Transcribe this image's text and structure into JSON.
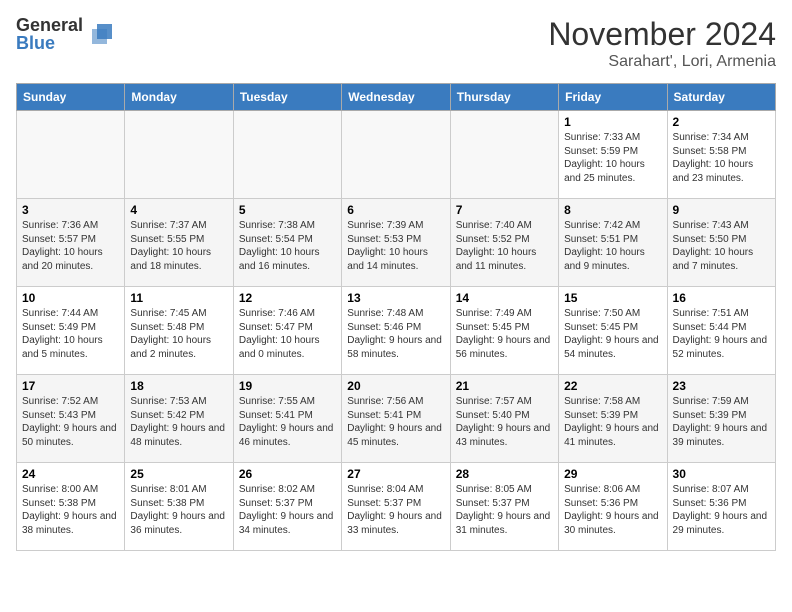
{
  "header": {
    "logo_general": "General",
    "logo_blue": "Blue",
    "month": "November 2024",
    "location": "Sarahart', Lori, Armenia"
  },
  "weekdays": [
    "Sunday",
    "Monday",
    "Tuesday",
    "Wednesday",
    "Thursday",
    "Friday",
    "Saturday"
  ],
  "weeks": [
    [
      {
        "day": "",
        "info": ""
      },
      {
        "day": "",
        "info": ""
      },
      {
        "day": "",
        "info": ""
      },
      {
        "day": "",
        "info": ""
      },
      {
        "day": "",
        "info": ""
      },
      {
        "day": "1",
        "info": "Sunrise: 7:33 AM\nSunset: 5:59 PM\nDaylight: 10 hours and 25 minutes."
      },
      {
        "day": "2",
        "info": "Sunrise: 7:34 AM\nSunset: 5:58 PM\nDaylight: 10 hours and 23 minutes."
      }
    ],
    [
      {
        "day": "3",
        "info": "Sunrise: 7:36 AM\nSunset: 5:57 PM\nDaylight: 10 hours and 20 minutes."
      },
      {
        "day": "4",
        "info": "Sunrise: 7:37 AM\nSunset: 5:55 PM\nDaylight: 10 hours and 18 minutes."
      },
      {
        "day": "5",
        "info": "Sunrise: 7:38 AM\nSunset: 5:54 PM\nDaylight: 10 hours and 16 minutes."
      },
      {
        "day": "6",
        "info": "Sunrise: 7:39 AM\nSunset: 5:53 PM\nDaylight: 10 hours and 14 minutes."
      },
      {
        "day": "7",
        "info": "Sunrise: 7:40 AM\nSunset: 5:52 PM\nDaylight: 10 hours and 11 minutes."
      },
      {
        "day": "8",
        "info": "Sunrise: 7:42 AM\nSunset: 5:51 PM\nDaylight: 10 hours and 9 minutes."
      },
      {
        "day": "9",
        "info": "Sunrise: 7:43 AM\nSunset: 5:50 PM\nDaylight: 10 hours and 7 minutes."
      }
    ],
    [
      {
        "day": "10",
        "info": "Sunrise: 7:44 AM\nSunset: 5:49 PM\nDaylight: 10 hours and 5 minutes."
      },
      {
        "day": "11",
        "info": "Sunrise: 7:45 AM\nSunset: 5:48 PM\nDaylight: 10 hours and 2 minutes."
      },
      {
        "day": "12",
        "info": "Sunrise: 7:46 AM\nSunset: 5:47 PM\nDaylight: 10 hours and 0 minutes."
      },
      {
        "day": "13",
        "info": "Sunrise: 7:48 AM\nSunset: 5:46 PM\nDaylight: 9 hours and 58 minutes."
      },
      {
        "day": "14",
        "info": "Sunrise: 7:49 AM\nSunset: 5:45 PM\nDaylight: 9 hours and 56 minutes."
      },
      {
        "day": "15",
        "info": "Sunrise: 7:50 AM\nSunset: 5:45 PM\nDaylight: 9 hours and 54 minutes."
      },
      {
        "day": "16",
        "info": "Sunrise: 7:51 AM\nSunset: 5:44 PM\nDaylight: 9 hours and 52 minutes."
      }
    ],
    [
      {
        "day": "17",
        "info": "Sunrise: 7:52 AM\nSunset: 5:43 PM\nDaylight: 9 hours and 50 minutes."
      },
      {
        "day": "18",
        "info": "Sunrise: 7:53 AM\nSunset: 5:42 PM\nDaylight: 9 hours and 48 minutes."
      },
      {
        "day": "19",
        "info": "Sunrise: 7:55 AM\nSunset: 5:41 PM\nDaylight: 9 hours and 46 minutes."
      },
      {
        "day": "20",
        "info": "Sunrise: 7:56 AM\nSunset: 5:41 PM\nDaylight: 9 hours and 45 minutes."
      },
      {
        "day": "21",
        "info": "Sunrise: 7:57 AM\nSunset: 5:40 PM\nDaylight: 9 hours and 43 minutes."
      },
      {
        "day": "22",
        "info": "Sunrise: 7:58 AM\nSunset: 5:39 PM\nDaylight: 9 hours and 41 minutes."
      },
      {
        "day": "23",
        "info": "Sunrise: 7:59 AM\nSunset: 5:39 PM\nDaylight: 9 hours and 39 minutes."
      }
    ],
    [
      {
        "day": "24",
        "info": "Sunrise: 8:00 AM\nSunset: 5:38 PM\nDaylight: 9 hours and 38 minutes."
      },
      {
        "day": "25",
        "info": "Sunrise: 8:01 AM\nSunset: 5:38 PM\nDaylight: 9 hours and 36 minutes."
      },
      {
        "day": "26",
        "info": "Sunrise: 8:02 AM\nSunset: 5:37 PM\nDaylight: 9 hours and 34 minutes."
      },
      {
        "day": "27",
        "info": "Sunrise: 8:04 AM\nSunset: 5:37 PM\nDaylight: 9 hours and 33 minutes."
      },
      {
        "day": "28",
        "info": "Sunrise: 8:05 AM\nSunset: 5:37 PM\nDaylight: 9 hours and 31 minutes."
      },
      {
        "day": "29",
        "info": "Sunrise: 8:06 AM\nSunset: 5:36 PM\nDaylight: 9 hours and 30 minutes."
      },
      {
        "day": "30",
        "info": "Sunrise: 8:07 AM\nSunset: 5:36 PM\nDaylight: 9 hours and 29 minutes."
      }
    ]
  ]
}
